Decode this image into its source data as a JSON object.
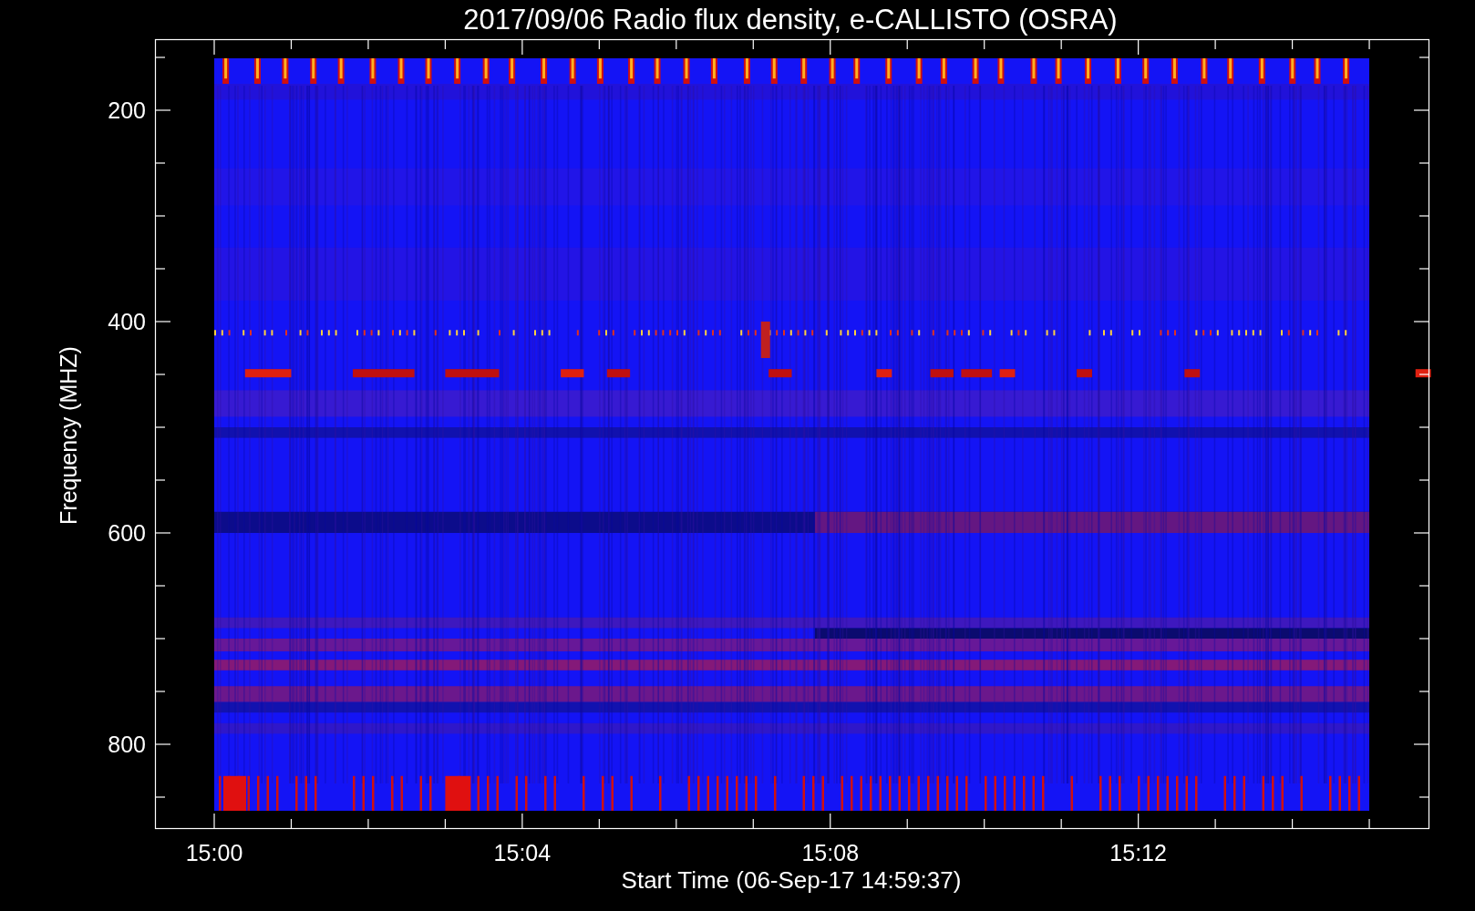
{
  "title": "2017/09/06  Radio flux density, e-CALLISTO (OSRA)",
  "y_axis": {
    "label": "Frequency (MHZ)",
    "ticks": [
      "200",
      "400",
      "600",
      "800"
    ]
  },
  "x_axis": {
    "label": "Start Time (06-Sep-17 14:59:37)",
    "ticks": [
      "15:00",
      "15:04",
      "15:08",
      "15:12"
    ]
  }
}
